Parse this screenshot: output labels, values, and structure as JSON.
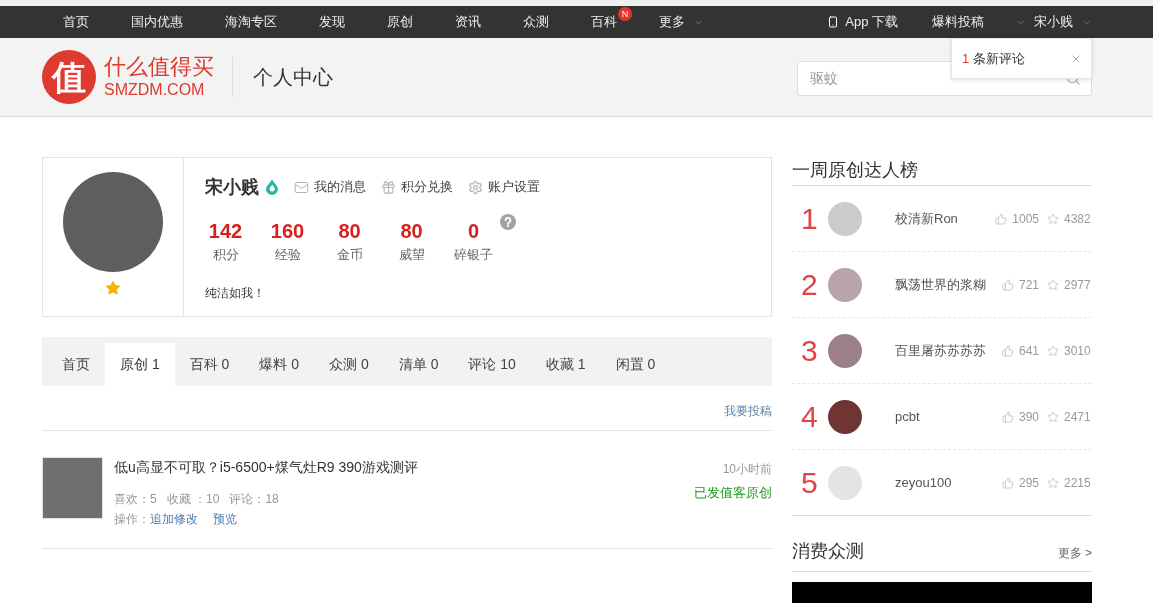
{
  "top_nav": {
    "items": [
      {
        "label": "首页",
        "has_menu": false
      },
      {
        "label": "国内优惠",
        "has_menu": false
      },
      {
        "label": "海淘专区",
        "has_menu": false
      },
      {
        "label": "发现",
        "has_menu": false
      },
      {
        "label": "原创",
        "has_menu": false
      },
      {
        "label": "资讯",
        "has_menu": false
      },
      {
        "label": "众测",
        "has_menu": false
      },
      {
        "label": "百科",
        "has_menu": false,
        "badge": "N"
      },
      {
        "label": "更多",
        "has_menu": true
      }
    ],
    "right_items": [
      {
        "kind": "app",
        "label": "App 下载",
        "has_menu": false
      },
      {
        "kind": "text",
        "label": "爆料投稿",
        "has_menu": true
      },
      {
        "kind": "text",
        "label": "宋小贱",
        "has_menu": true
      }
    ]
  },
  "header": {
    "logo": {
      "glyph": "值",
      "name": "什么值得买",
      "domain": "SMZDM.COM"
    },
    "page_title": "个人中心",
    "search": {
      "placeholder": "驱蚊"
    },
    "notification": {
      "count": "1",
      "text": "条新评论"
    }
  },
  "profile": {
    "name": "宋小贱",
    "links": [
      {
        "kind": "mail",
        "label": "我的消息"
      },
      {
        "kind": "gift",
        "label": "积分兑换"
      },
      {
        "kind": "settings",
        "label": "账户设置"
      }
    ],
    "stats": [
      {
        "value": "142",
        "label": "积分"
      },
      {
        "value": "160",
        "label": "经验"
      },
      {
        "value": "80",
        "label": "金币"
      },
      {
        "value": "80",
        "label": "威望"
      },
      {
        "value": "0",
        "label": "碎银子"
      }
    ],
    "bio": "纯洁如我！"
  },
  "tabs": [
    {
      "label": "首页",
      "selected": false
    },
    {
      "label": "原创 1",
      "selected": true
    },
    {
      "label": "百科 0",
      "selected": false
    },
    {
      "label": "爆料 0",
      "selected": false
    },
    {
      "label": "众测 0",
      "selected": false
    },
    {
      "label": "清单 0",
      "selected": false
    },
    {
      "label": "评论 10",
      "selected": false
    },
    {
      "label": "收藏 1",
      "selected": false
    },
    {
      "label": "闲置 0",
      "selected": false
    }
  ],
  "posts": {
    "submit_link": "我要投稿",
    "items": [
      {
        "title": "低u高显不可取？i5-6500+煤气灶R9 390游戏测评",
        "meta": [
          "喜欢：5",
          "收藏 ：10",
          "评论：18"
        ],
        "actions_label": "操作：",
        "actions": [
          "追加修改",
          "预览"
        ],
        "time": "10小时前",
        "status": "已发值客原创"
      }
    ]
  },
  "sidebar": {
    "ranking": {
      "title": "一周原创达人榜",
      "rows": [
        {
          "rank": "1",
          "name": "校清新Ron",
          "likes": "1005",
          "favorites": "4382"
        },
        {
          "rank": "2",
          "name": "飘荡世界的浆糊",
          "likes": "721",
          "favorites": "2977"
        },
        {
          "rank": "3",
          "name": "百里屠苏苏苏苏",
          "likes": "641",
          "favorites": "3010"
        },
        {
          "rank": "4",
          "name": "pcbt",
          "likes": "390",
          "favorites": "2471"
        },
        {
          "rank": "5",
          "name": "zeyou100",
          "likes": "295",
          "favorites": "2215"
        }
      ]
    },
    "trials": {
      "title": "消费众测",
      "more": "更多 >"
    }
  }
}
